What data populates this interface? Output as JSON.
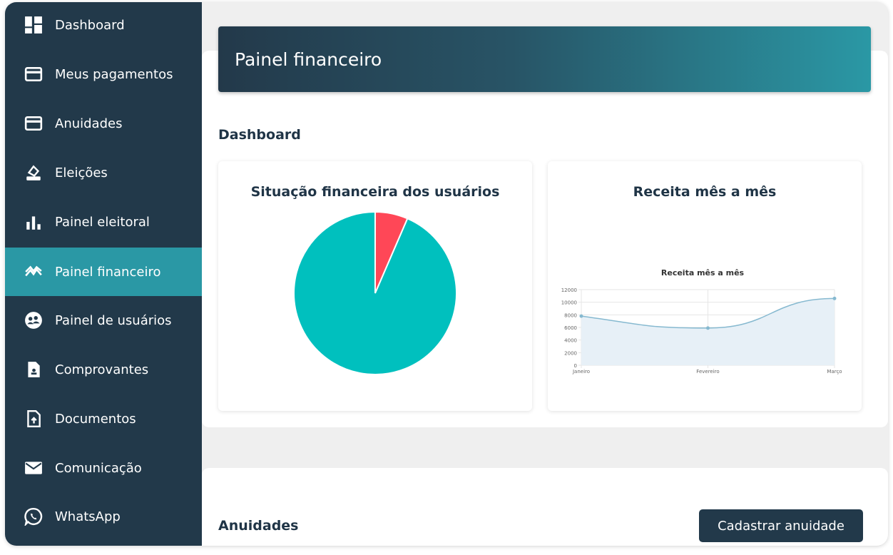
{
  "sidebar": {
    "items": [
      {
        "label": "Dashboard",
        "icon": "dashboard-icon"
      },
      {
        "label": "Meus pagamentos",
        "icon": "credit-card-icon"
      },
      {
        "label": "Anuidades",
        "icon": "credit-card-icon"
      },
      {
        "label": "Eleições",
        "icon": "ballot-icon"
      },
      {
        "label": "Painel eleitoral",
        "icon": "bar-chart-icon"
      },
      {
        "label": "Painel financeiro",
        "icon": "trend-icon",
        "active": true
      },
      {
        "label": "Painel de usuários",
        "icon": "users-icon"
      },
      {
        "label": "Comprovantes",
        "icon": "receipt-icon"
      },
      {
        "label": "Documentos",
        "icon": "document-upload-icon"
      },
      {
        "label": "Comunicação",
        "icon": "mail-icon"
      },
      {
        "label": "WhatsApp",
        "icon": "whatsapp-icon"
      }
    ]
  },
  "header": {
    "title": "Painel financeiro"
  },
  "dashboard": {
    "title": "Dashboard"
  },
  "cards": {
    "pie_title": "Situação financeira dos usuários",
    "line_title": "Receita mês a mês"
  },
  "anuidades": {
    "title": "Anuidades",
    "button_label": "Cadastrar anuidade"
  },
  "colors": {
    "sidebar_bg": "#22394a",
    "active_bg": "#2a98a5",
    "pie_main": "#00c0be",
    "pie_alert": "#ff4757",
    "line": "#86b9d0",
    "line_fill": "#e7f0f7"
  },
  "chart_data": [
    {
      "type": "pie",
      "title": "Situação financeira dos usuários",
      "slices": [
        {
          "value": 6.5,
          "color": "#ff4757"
        },
        {
          "value": 93.5,
          "color": "#00c0be"
        }
      ]
    },
    {
      "type": "area",
      "title": "Receita mês a mês",
      "categories": [
        "Janeiro",
        "Fevereiro",
        "Março"
      ],
      "values": [
        7800,
        5900,
        10600
      ],
      "ylim": [
        0,
        12000
      ],
      "yticks": [
        0,
        2000,
        4000,
        6000,
        8000,
        10000,
        12000
      ],
      "grid": true
    }
  ]
}
